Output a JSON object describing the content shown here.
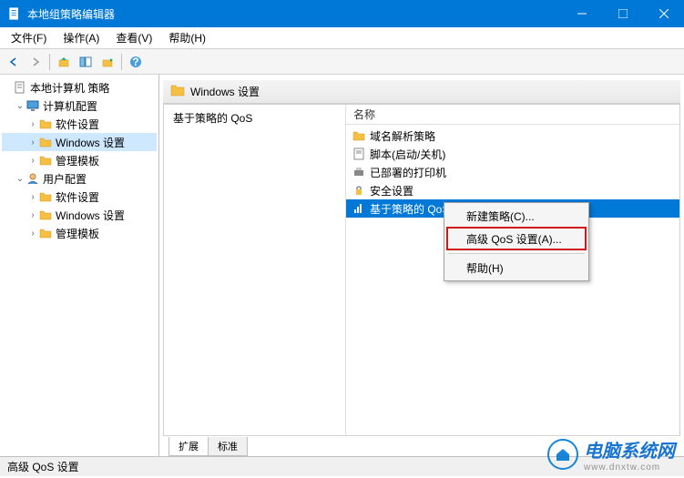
{
  "window": {
    "title": "本地组策略编辑器"
  },
  "menu": {
    "file": "文件(F)",
    "action": "操作(A)",
    "view": "查看(V)",
    "help": "帮助(H)"
  },
  "tree": {
    "root": "本地计算机 策略",
    "computer": "计算机配置",
    "user": "用户配置",
    "software": "软件设置",
    "windows": "Windows 设置",
    "templates": "管理模板"
  },
  "content": {
    "header": "Windows 设置",
    "desc_title": "基于策略的 QoS",
    "list_header": "名称",
    "items": {
      "dns": "域名解析策略",
      "script": "脚本(启动/关机)",
      "printer": "已部署的打印机",
      "security": "安全设置",
      "qos": "基于策略的 QoS"
    }
  },
  "tabs": {
    "extended": "扩展",
    "standard": "标准"
  },
  "context": {
    "new_policy": "新建策略(C)...",
    "advanced": "高级 QoS 设置(A)...",
    "help": "帮助(H)"
  },
  "status": "高级 QoS 设置",
  "watermark": {
    "text": "电脑系统网",
    "sub": "www.dnxtw.com"
  }
}
